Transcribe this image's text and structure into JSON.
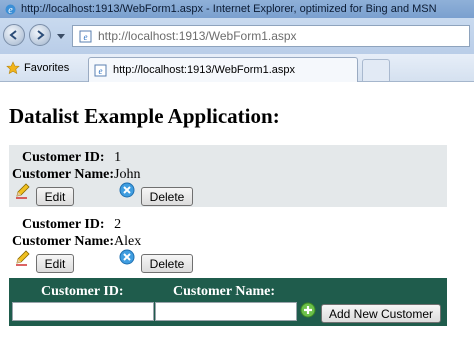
{
  "browser": {
    "title": "http://localhost:1913/WebForm1.aspx - Internet Explorer, optimized for Bing and MSN",
    "address": "http://localhost:1913/WebForm1.aspx",
    "favorites_label": "Favorites",
    "tab_label": "http://localhost:1913/WebForm1.aspx"
  },
  "page": {
    "heading": "Datalist Example Application:",
    "id_label": "Customer ID:",
    "name_label": "Customer Name:",
    "edit_label": "Edit",
    "delete_label": "Delete",
    "records": [
      {
        "id": "1",
        "name": "John"
      },
      {
        "id": "2",
        "name": "Alex"
      }
    ],
    "footer": {
      "id_label": "Customer ID:",
      "name_label": "Customer Name:",
      "id_value": "",
      "name_value": "",
      "add_label": "Add New Customer"
    }
  },
  "colors": {
    "alt_row": "#e4e8ea",
    "footer_bg": "#1f5c4c"
  },
  "icons": [
    "ie-logo-icon",
    "back-arrow-icon",
    "forward-arrow-icon",
    "dropdown-icon",
    "page-icon",
    "favorites-star-icon",
    "edit-pencil-icon",
    "delete-x-icon",
    "add-plus-icon"
  ]
}
